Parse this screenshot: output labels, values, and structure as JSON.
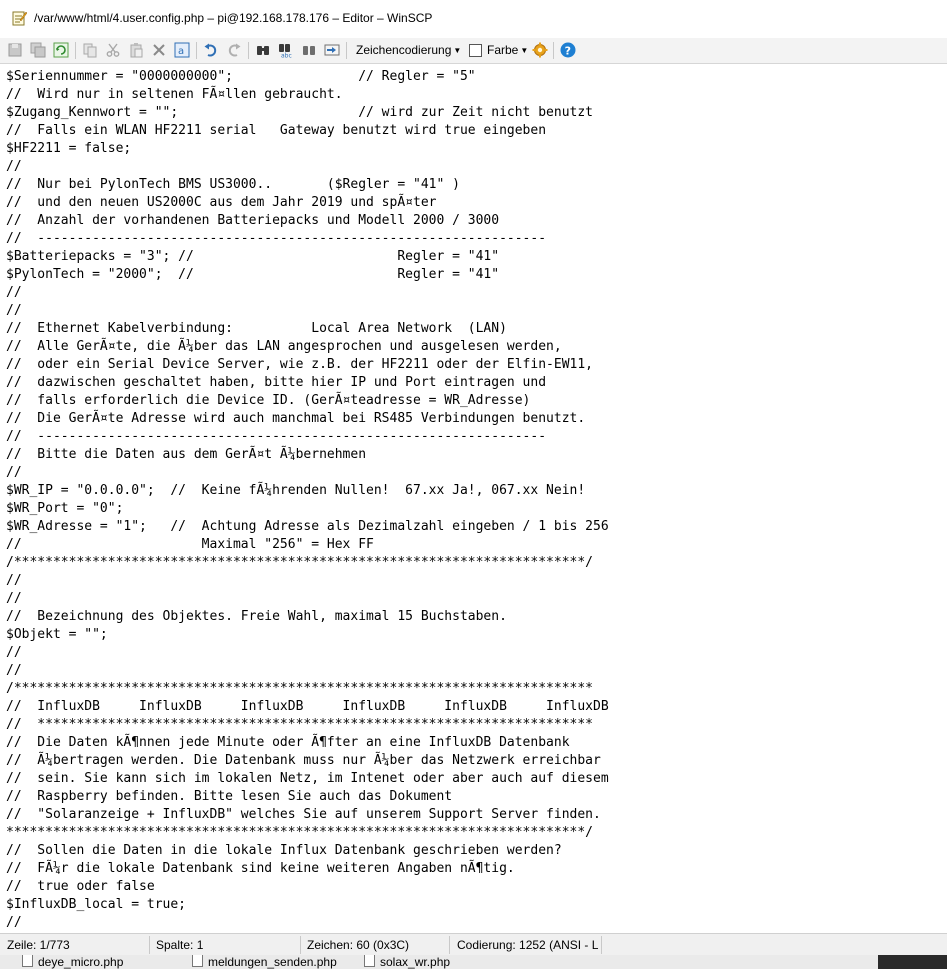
{
  "window": {
    "title": "/var/www/html/4.user.config.php – pi@192.168.178.176 – Editor – WinSCP"
  },
  "toolbar": {
    "encoding_label": "Zeichencodierung",
    "color_label": "Farbe"
  },
  "editor": {
    "lines": [
      "$Seriennummer = \"0000000000\";                // Regler = \"5\"",
      "//  Wird nur in seltenen FÃ¤llen gebraucht.",
      "$Zugang_Kennwort = \"\";                       // wird zur Zeit nicht benutzt",
      "//  Falls ein WLAN HF2211 serial   Gateway benutzt wird true eingeben",
      "$HF2211 = false;",
      "//",
      "//  Nur bei PylonTech BMS US3000..       ($Regler = \"41\" )",
      "//  und den neuen US2000C aus dem Jahr 2019 und spÃ¤ter",
      "//  Anzahl der vorhandenen Batteriepacks und Modell 2000 / 3000",
      "//  -----------------------------------------------------------------",
      "$Batteriepacks = \"3\"; //                          Regler = \"41\"",
      "$PylonTech = \"2000\";  //                          Regler = \"41\"",
      "//",
      "//",
      "//  Ethernet Kabelverbindung:          Local Area Network  (LAN)",
      "//  Alle GerÃ¤te, die Ã¼ber das LAN angesprochen und ausgelesen werden,",
      "//  oder ein Serial Device Server, wie z.B. der HF2211 oder der Elfin-EW11,",
      "//  dazwischen geschaltet haben, bitte hier IP und Port eintragen und",
      "//  falls erforderlich die Device ID. (GerÃ¤teadresse = WR_Adresse)",
      "//  Die GerÃ¤te Adresse wird auch manchmal bei RS485 Verbindungen benutzt.",
      "//  -----------------------------------------------------------------",
      "//  Bitte die Daten aus dem GerÃ¤t Ã¼bernehmen",
      "//",
      "$WR_IP = \"0.0.0.0\";  //  Keine fÃ¼hrenden Nullen!  67.xx Ja!, 067.xx Nein!",
      "$WR_Port = \"0\";",
      "$WR_Adresse = \"1\";   //  Achtung Adresse als Dezimalzahl eingeben / 1 bis 256",
      "//                       Maximal \"256\" = Hex FF",
      "/*************************************************************************/",
      "//",
      "//",
      "//  Bezeichnung des Objektes. Freie Wahl, maximal 15 Buchstaben.",
      "$Objekt = \"\";",
      "//",
      "//",
      "/**************************************************************************",
      "//  InfluxDB     InfluxDB     InfluxDB     InfluxDB     InfluxDB     InfluxDB",
      "//  ***********************************************************************",
      "//  Die Daten kÃ¶nnen jede Minute oder Ã¶fter an eine InfluxDB Datenbank",
      "//  Ã¼bertragen werden. Die Datenbank muss nur Ã¼ber das Netzwerk erreichbar",
      "//  sein. Sie kann sich im lokalen Netz, im Intenet oder aber auch auf diesem",
      "//  Raspberry befinden. Bitte lesen Sie auch das Dokument",
      "//  \"Solaranzeige + InfluxDB\" welches Sie auf unserem Support Server finden.",
      "**************************************************************************/",
      "//  Sollen die Daten in die lokale Influx Datenbank geschrieben werden?",
      "//  FÃ¼r die lokale Datenbank sind keine weiteren Angaben nÃ¶tig.",
      "//  true oder false",
      "$InfluxDB_local = true;",
      "//"
    ]
  },
  "statusbar": {
    "line": "Zeile: 1/773",
    "column": "Spalte: 1",
    "character": "Zeichen: 60 (0x3C)",
    "encoding": "Codierung: 1252  (ANSI - L"
  },
  "taskbar": {
    "files": [
      "deye_micro.php",
      "meldungen_senden.php",
      "solax_wr.php"
    ]
  },
  "colors": {
    "accent_blue": "#2f6fb5",
    "accent_orange": "#e8a21a",
    "help_blue": "#1e7fd2"
  },
  "icons": [
    "notepad-icon",
    "save-icon",
    "save-all-icon",
    "reload-icon",
    "copy-icon",
    "cut-icon",
    "paste-icon",
    "delete-icon",
    "select-all-icon",
    "undo-icon",
    "redo-icon",
    "find-icon",
    "replace-icon",
    "find-next-icon",
    "goto-line-icon",
    "settings-icon",
    "help-icon"
  ]
}
